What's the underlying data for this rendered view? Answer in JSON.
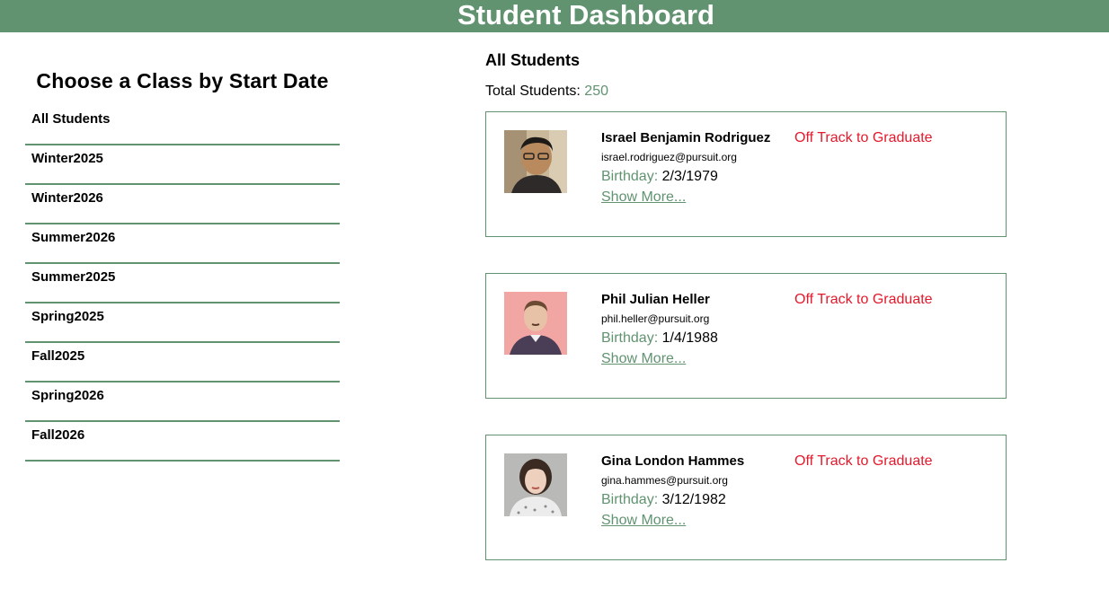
{
  "header": {
    "title": "Student Dashboard"
  },
  "sidebar": {
    "title": "Choose a Class by Start Date",
    "items": [
      {
        "label": "All Students"
      },
      {
        "label": "Winter2025"
      },
      {
        "label": "Winter2026"
      },
      {
        "label": "Summer2026"
      },
      {
        "label": "Summer2025"
      },
      {
        "label": "Spring2025"
      },
      {
        "label": "Fall2025"
      },
      {
        "label": "Spring2026"
      },
      {
        "label": "Fall2026"
      }
    ]
  },
  "main": {
    "heading": "All Students",
    "total_label": "Total Students: ",
    "total_count": "250",
    "students": [
      {
        "name": "Israel Benjamin Rodriguez",
        "email": "israel.rodriguez@pursuit.org",
        "birthday_label": "Birthday:",
        "birthday": "2/3/1979",
        "show_more": "Show More...",
        "status": "Off Track to Graduate"
      },
      {
        "name": "Phil Julian Heller",
        "email": "phil.heller@pursuit.org",
        "birthday_label": "Birthday:",
        "birthday": "1/4/1988",
        "show_more": "Show More...",
        "status": "Off Track to Graduate"
      },
      {
        "name": "Gina London Hammes",
        "email": "gina.hammes@pursuit.org",
        "birthday_label": "Birthday:",
        "birthday": "3/12/1982",
        "show_more": "Show More...",
        "status": "Off Track to Graduate"
      }
    ]
  },
  "colors": {
    "accent": "#619371",
    "status_off_track": "#e3192b"
  }
}
